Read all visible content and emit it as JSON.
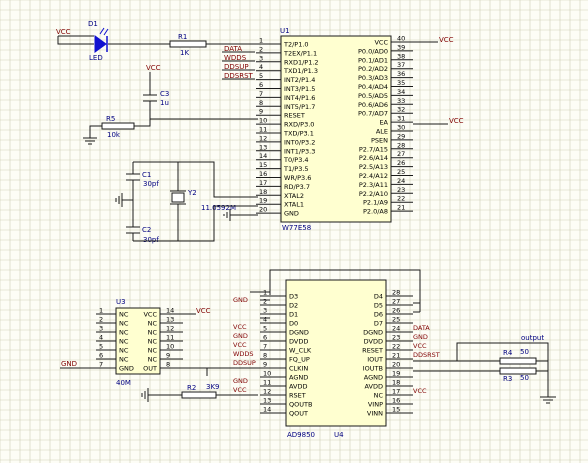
{
  "colors": {
    "grid": "#cfcfb8",
    "wire": "#1a1a1a",
    "pin_text": "#000000",
    "label_text": "#000080",
    "net_text": "#800000",
    "chip_fill": "#ffffd0",
    "led": "#1010d0",
    "background": "#fdfdf6"
  },
  "u1": {
    "designator": "U1",
    "part": "W77E58",
    "left_pins": [
      {
        "num": "1",
        "name": "T2/P1.0"
      },
      {
        "num": "2",
        "name": "T2EX/P1.1"
      },
      {
        "num": "3",
        "name": "RXD1/P1.2"
      },
      {
        "num": "4",
        "name": "TXD1/P1.3"
      },
      {
        "num": "5",
        "name": "INT2/P1.4"
      },
      {
        "num": "6",
        "name": "INT3/P1.5"
      },
      {
        "num": "7",
        "name": "INT4/P1.6"
      },
      {
        "num": "8",
        "name": "INT5/P1.7"
      },
      {
        "num": "9",
        "name": "RESET"
      },
      {
        "num": "10",
        "name": "RXD/P3.0"
      },
      {
        "num": "11",
        "name": "TXD/P3.1"
      },
      {
        "num": "12",
        "name": "INT0/P3.2"
      },
      {
        "num": "13",
        "name": "INT1/P3.3"
      },
      {
        "num": "14",
        "name": "T0/P3.4"
      },
      {
        "num": "15",
        "name": "T1/P3.5"
      },
      {
        "num": "16",
        "name": "WR/P3.6"
      },
      {
        "num": "17",
        "name": "RD/P3.7"
      },
      {
        "num": "18",
        "name": "XTAL2"
      },
      {
        "num": "19",
        "name": "XTAL1"
      },
      {
        "num": "20",
        "name": "GND"
      }
    ],
    "right_pins": [
      {
        "num": "40",
        "name": "VCC"
      },
      {
        "num": "39",
        "name": "P0.0/AD0"
      },
      {
        "num": "38",
        "name": "P0.1/AD1"
      },
      {
        "num": "37",
        "name": "P0.2/AD2"
      },
      {
        "num": "36",
        "name": "P0.3/AD3"
      },
      {
        "num": "35",
        "name": "P0.4/AD4"
      },
      {
        "num": "34",
        "name": "P0.5/AD5"
      },
      {
        "num": "33",
        "name": "P0.6/AD6"
      },
      {
        "num": "32",
        "name": "P0.7/AD7"
      },
      {
        "num": "31",
        "name": "EA"
      },
      {
        "num": "30",
        "name": "ALE"
      },
      {
        "num": "29",
        "name": "PSEN"
      },
      {
        "num": "28",
        "name": "P2.7/A15"
      },
      {
        "num": "27",
        "name": "P2.6/A14"
      },
      {
        "num": "26",
        "name": "P2.5/A13"
      },
      {
        "num": "25",
        "name": "P2.4/A12"
      },
      {
        "num": "24",
        "name": "P2.3/A11"
      },
      {
        "num": "23",
        "name": "P2.2/A10"
      },
      {
        "num": "22",
        "name": "P2.1/A9"
      },
      {
        "num": "21",
        "name": "P2.0/A8"
      }
    ],
    "net_labels": [
      "DATA",
      "WDDS",
      "DDSUP",
      "DDSRST"
    ],
    "vcc_right": [
      "VCC",
      "VCC"
    ]
  },
  "u4": {
    "designator": "U4",
    "part": "AD9850",
    "left_pins": [
      {
        "num": "1",
        "name": "D3"
      },
      {
        "num": "2",
        "name": "D2"
      },
      {
        "num": "3",
        "name": "D1"
      },
      {
        "num": "4",
        "name": "D0"
      },
      {
        "num": "5",
        "name": "DGND"
      },
      {
        "num": "6",
        "name": "DVDD"
      },
      {
        "num": "7",
        "name": "W_CLK"
      },
      {
        "num": "8",
        "name": "FQ_UP"
      },
      {
        "num": "9",
        "name": "CLKIN"
      },
      {
        "num": "10",
        "name": "AGND"
      },
      {
        "num": "11",
        "name": "AVDD"
      },
      {
        "num": "12",
        "name": "RSET"
      },
      {
        "num": "13",
        "name": "QOUTB"
      },
      {
        "num": "14",
        "name": "QOUT"
      }
    ],
    "right_pins": [
      {
        "num": "28",
        "name": "D4"
      },
      {
        "num": "27",
        "name": "D5"
      },
      {
        "num": "26",
        "name": "D6"
      },
      {
        "num": "25",
        "name": "D7"
      },
      {
        "num": "24",
        "name": "DGND"
      },
      {
        "num": "23",
        "name": "DVDD"
      },
      {
        "num": "22",
        "name": "RESET"
      },
      {
        "num": "21",
        "name": "IOUT"
      },
      {
        "num": "20",
        "name": "IOUTB"
      },
      {
        "num": "19",
        "name": "AGND"
      },
      {
        "num": "18",
        "name": "AVDD"
      },
      {
        "num": "17",
        "name": "NC"
      },
      {
        "num": "16",
        "name": "VINP"
      },
      {
        "num": "15",
        "name": "VINN"
      }
    ],
    "left_nets": [
      "GND",
      "",
      "",
      "VCC",
      "GND",
      "VCC",
      "WDDS",
      "DDSUP",
      "",
      "GND",
      "VCC",
      "",
      "",
      ""
    ],
    "right_nets": [
      "",
      "",
      "",
      "DATA",
      "GND",
      "VCC",
      "DDSRST",
      "",
      "",
      "",
      "VCC",
      "",
      "",
      ""
    ]
  },
  "u3": {
    "designator": "U3",
    "part": "40M",
    "left_pins": [
      {
        "num": "1",
        "name": "NC"
      },
      {
        "num": "2",
        "name": "NC"
      },
      {
        "num": "3",
        "name": "NC"
      },
      {
        "num": "4",
        "name": "NC"
      },
      {
        "num": "5",
        "name": "NC"
      },
      {
        "num": "6",
        "name": "NC"
      },
      {
        "num": "7",
        "name": "GND"
      }
    ],
    "right_pins": [
      {
        "num": "14",
        "name": "VCC"
      },
      {
        "num": "13",
        "name": "NC"
      },
      {
        "num": "12",
        "name": "NC"
      },
      {
        "num": "11",
        "name": "NC"
      },
      {
        "num": "10",
        "name": "NC"
      },
      {
        "num": "9",
        "name": "NC"
      },
      {
        "num": "8",
        "name": "OUT"
      }
    ],
    "vcc_label": "VCC",
    "gnd_label": "GND"
  },
  "parts": {
    "d1": {
      "designator": "D1",
      "value": "LED",
      "net": "VCC"
    },
    "r1": {
      "designator": "R1",
      "value": "1K"
    },
    "c3": {
      "designator": "C3",
      "value": "1u",
      "net": "VCC"
    },
    "r5": {
      "designator": "R5",
      "value": "10k"
    },
    "c1": {
      "designator": "C1",
      "value": "30pf"
    },
    "c2": {
      "designator": "C2",
      "value": "30pf"
    },
    "y2": {
      "designator": "Y2",
      "value": "11.0592M"
    },
    "r2": {
      "designator": "R2",
      "value": "3K9"
    },
    "r4": {
      "designator": "R4",
      "value": "50"
    },
    "r3": {
      "designator": "R3",
      "value": "50"
    },
    "output": {
      "label": "output"
    }
  }
}
